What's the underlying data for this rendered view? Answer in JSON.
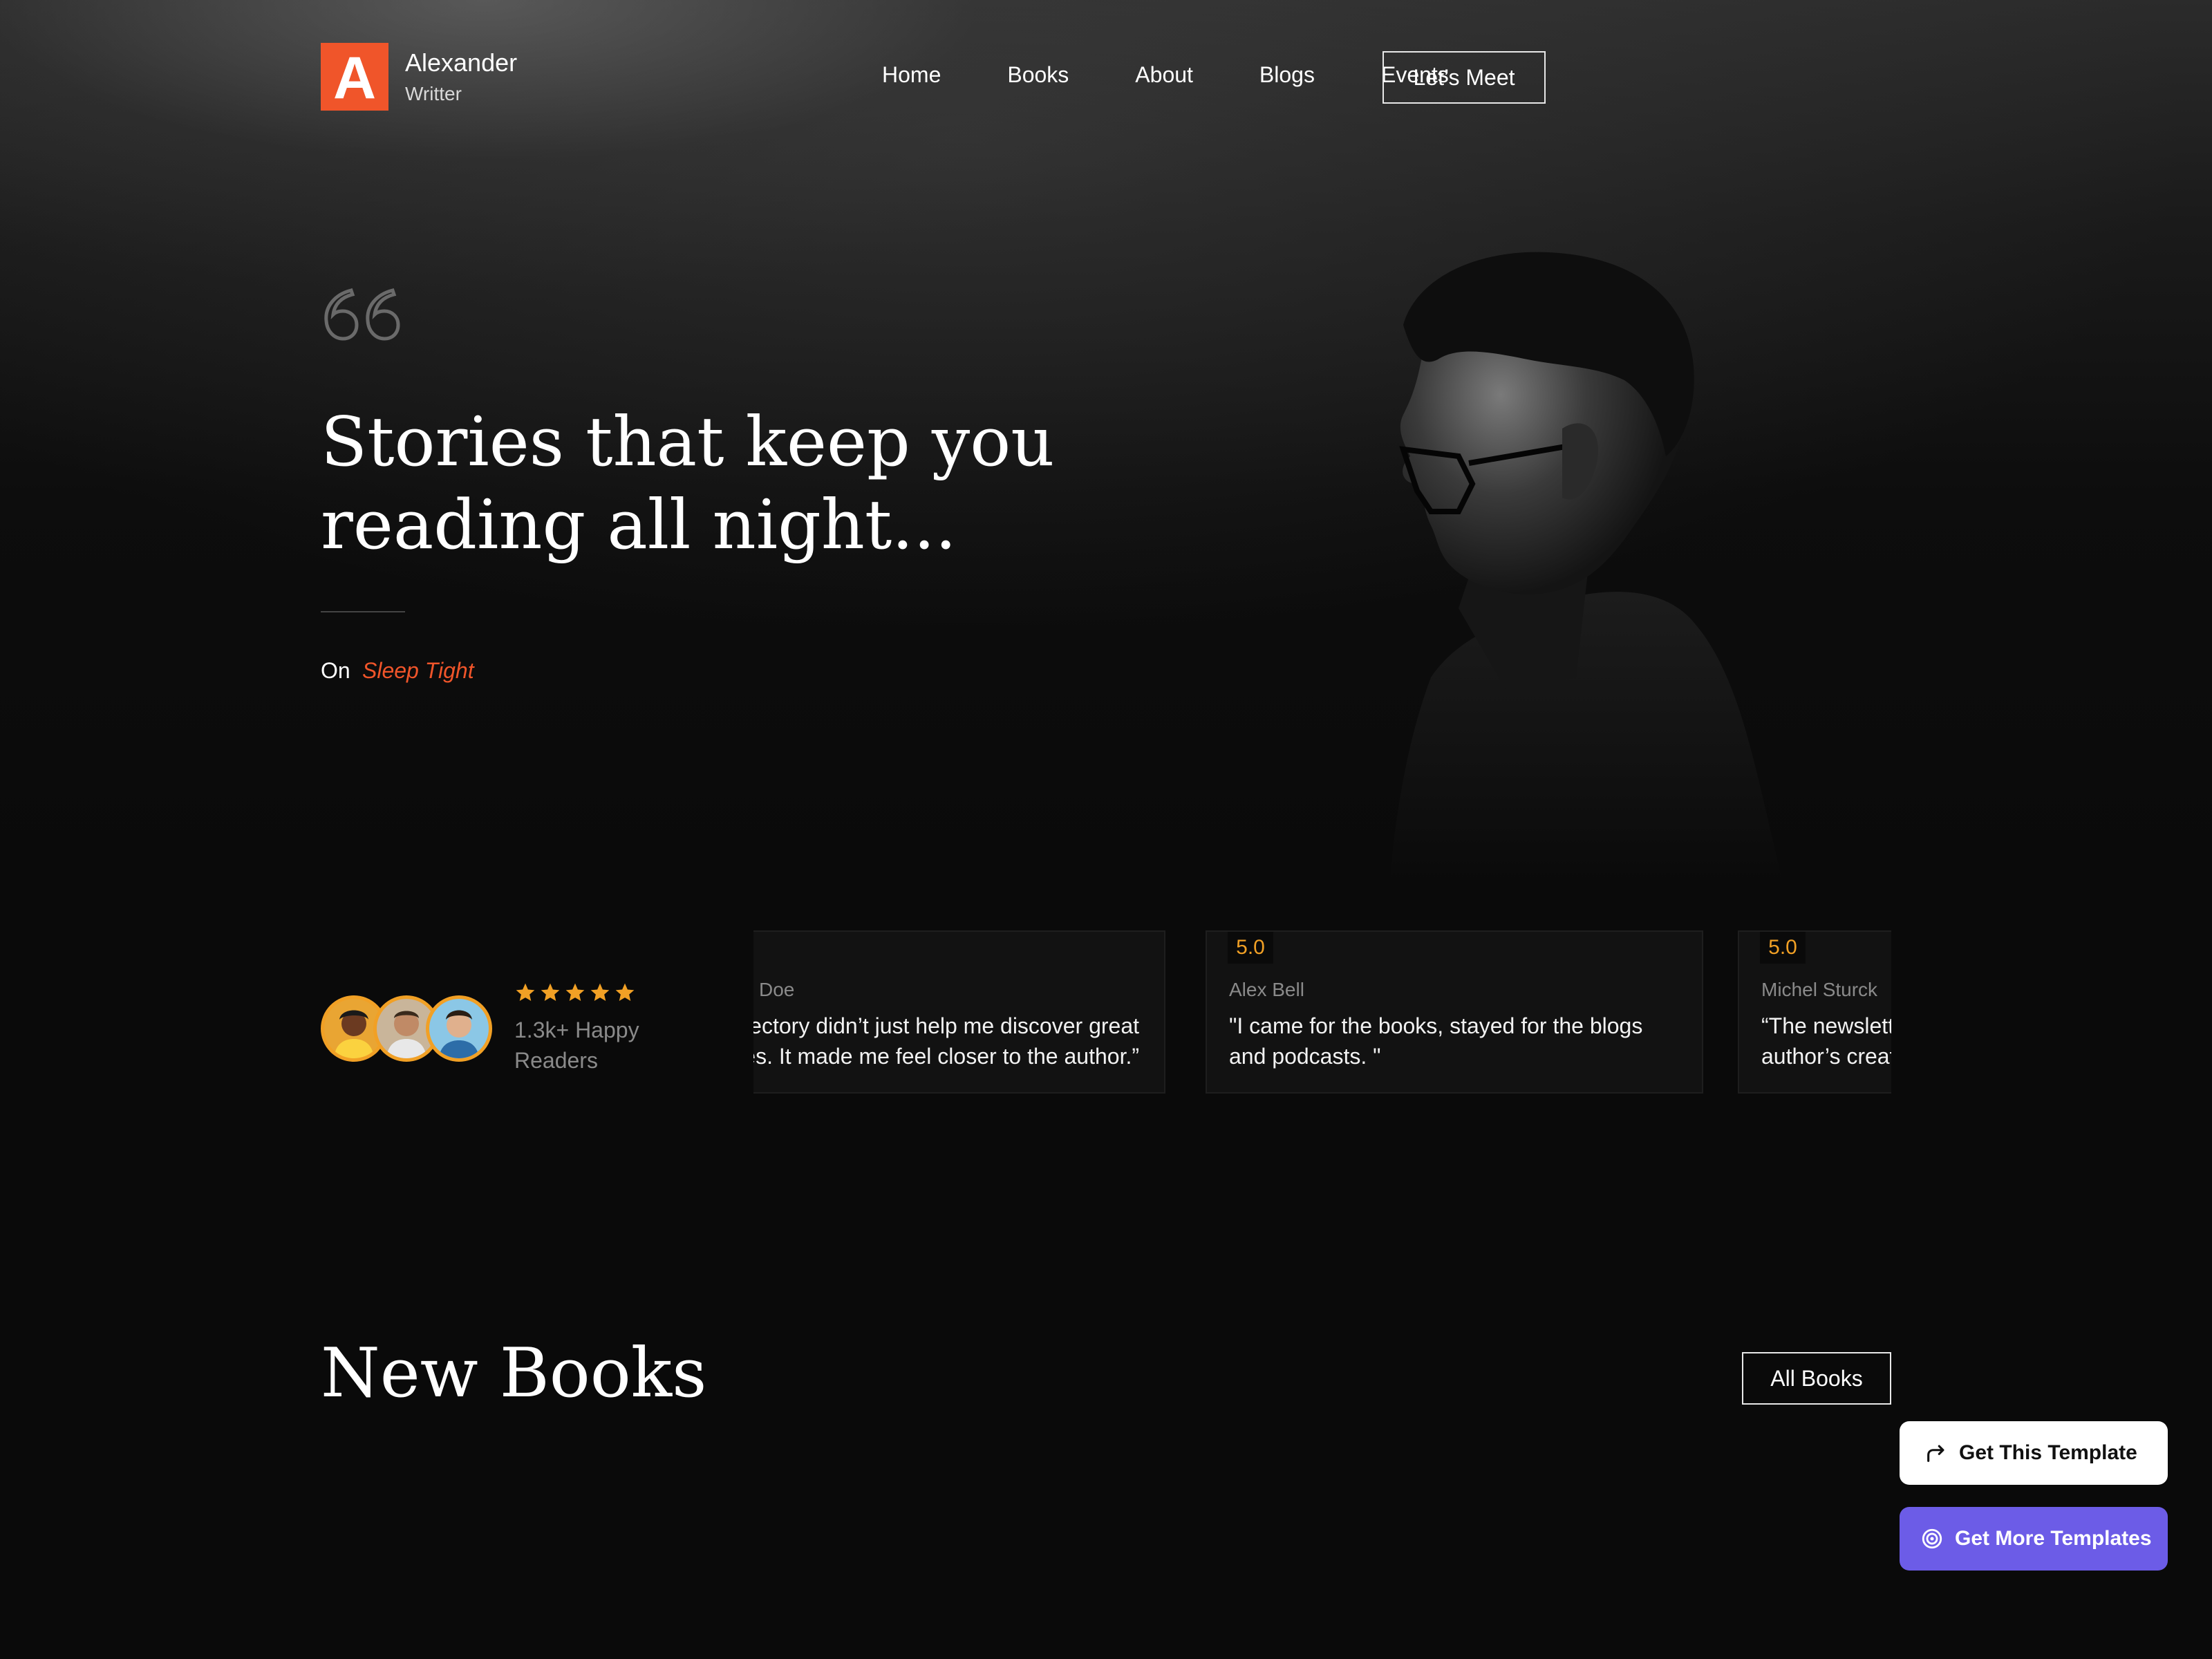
{
  "header": {
    "logo_letter": "A",
    "brand_name": "Alexander",
    "brand_role": "Writter",
    "nav": [
      "Home",
      "Books",
      "About",
      "Blogs",
      "Events"
    ],
    "cta": "Let’s Meet"
  },
  "hero": {
    "title": "Stories that keep you reading all night...",
    "on_label": "On",
    "book": "Sleep Tight"
  },
  "readers": {
    "rating_stars": 5,
    "text": "1.3k+ Happy Readers"
  },
  "reviews": [
    {
      "rating": "",
      "name": "Doe",
      "text": "The book directory didn’t just help me discover great stories. It made me feel closer to the author.”"
    },
    {
      "rating": "5.0",
      "name": "Alex Bell",
      "text": "\"I came for the books, stayed for the blogs and podcasts. \""
    },
    {
      "rating": "5.0",
      "name": "Michel Sturck",
      "text": "“The newsletter keeps me close to the author’s creative journey."
    }
  ],
  "books_section": {
    "title": "New Books",
    "button": "All Books"
  },
  "floating": {
    "get_template": "Get This Template",
    "more_templates": "Get More Templates"
  },
  "colors": {
    "accent": "#f0552a",
    "star": "#f1a025",
    "purple": "#6c5ce7",
    "background": "#0a0a0a"
  }
}
